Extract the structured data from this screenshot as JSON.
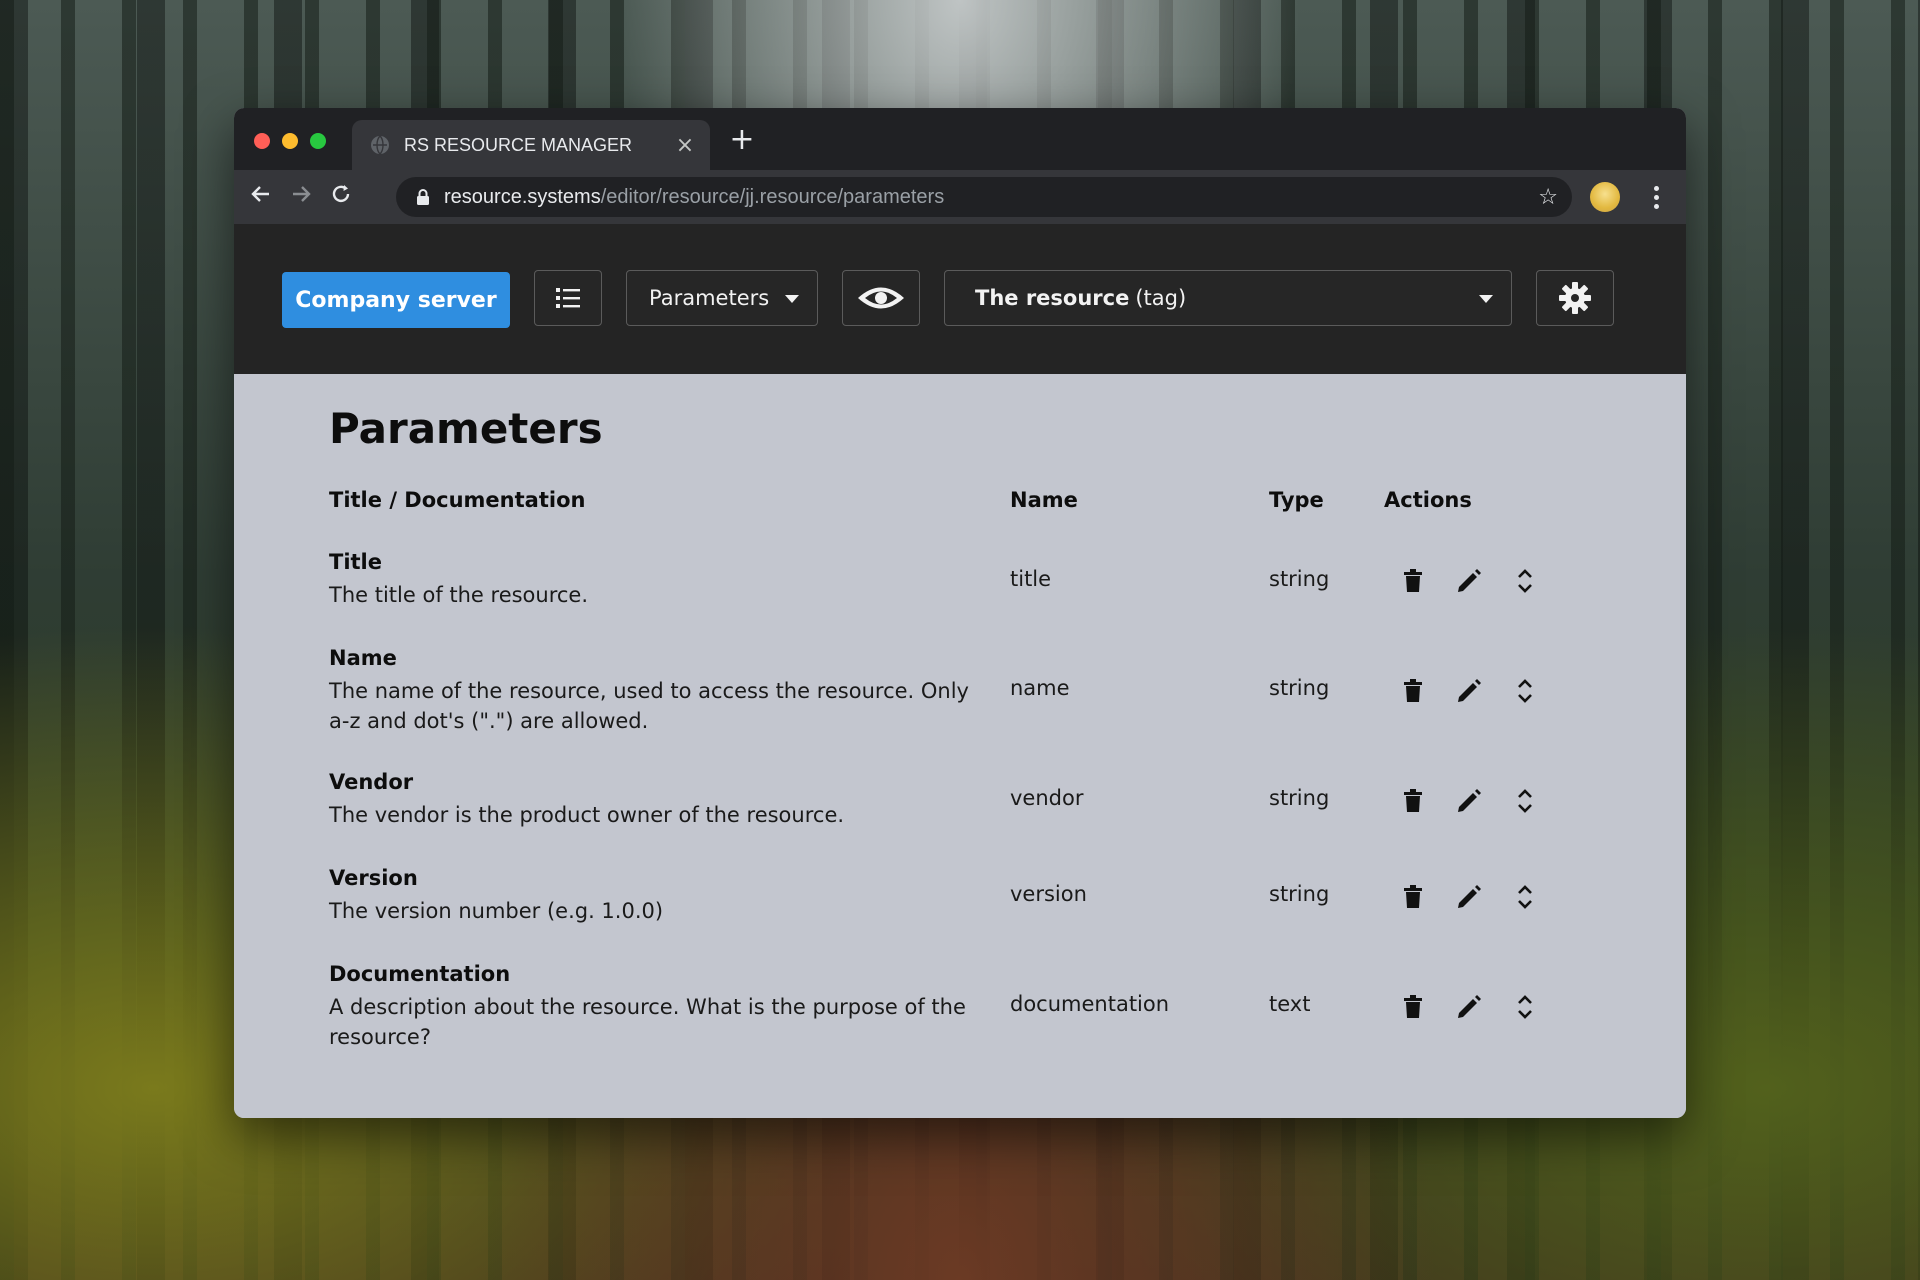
{
  "browser": {
    "tab_title": "RS RESOURCE MANAGER",
    "tab_close": "×",
    "new_tab": "+",
    "url_host": "resource.systems",
    "url_path": "/editor/resource/jj.resource/parameters",
    "icons": [
      "globe-icon",
      "lock-icon",
      "back-arrow-icon",
      "forward-arrow-icon",
      "reload-icon",
      "star-icon",
      "avatar",
      "kebab-menu-icon"
    ]
  },
  "header": {
    "server_button": "Company server",
    "parameters_dropdown": "Parameters",
    "resource_select_name": "The resource",
    "resource_select_tag": "(tag)",
    "icons": [
      "list-icon",
      "eye-icon",
      "gear-icon"
    ],
    "accent_color": "#2f8ee0"
  },
  "main": {
    "title": "Parameters",
    "columns": [
      "Title / Documentation",
      "Name",
      "Type",
      "Actions"
    ],
    "rows": [
      {
        "title": "Title",
        "doc": "The title of the resource.",
        "name": "title",
        "type": "string"
      },
      {
        "title": "Name",
        "doc": "The name of the resource, used to access the resource. Only a-z and dot's (\".\") are allowed.",
        "name": "name",
        "type": "string"
      },
      {
        "title": "Vendor",
        "doc": "The vendor is the product owner of the resource.",
        "name": "vendor",
        "type": "string"
      },
      {
        "title": "Version",
        "doc": "The version number (e.g. 1.0.0)",
        "name": "version",
        "type": "string"
      },
      {
        "title": "Documentation",
        "doc": "A description about the resource. What is the purpose of the resource?",
        "name": "documentation",
        "type": "text"
      }
    ],
    "action_icons": [
      "trash-icon",
      "pencil-icon",
      "sort-icon"
    ]
  }
}
